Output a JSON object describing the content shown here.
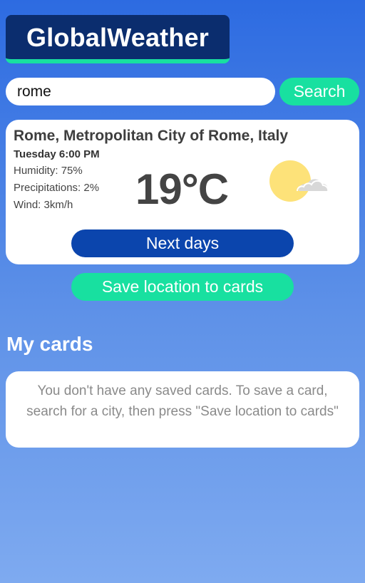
{
  "app": {
    "logo_text": "GlobalWeather"
  },
  "search": {
    "value": "rome",
    "button_label": "Search"
  },
  "weather": {
    "location": "Rome, Metropolitan City of Rome, Italy",
    "datetime": "Tuesday 6:00 PM",
    "humidity_label": "Humidity:",
    "humidity_value": "75%",
    "precipitation_label": "Precipitations:",
    "precipitation_value": "2%",
    "wind_label": "Wind:",
    "wind_value": "3km/h",
    "temperature": "19°C",
    "icon": "partly-sunny-icon",
    "next_days_label": "Next days"
  },
  "actions": {
    "save_location_label": "Save location to cards"
  },
  "cards": {
    "title": "My cards",
    "empty_message": "You don't have any saved cards. To save a card, search for a city, then press \"Save location to cards\""
  },
  "colors": {
    "accent": "#18e0a0",
    "logo_bg": "#0b2d6e",
    "next_days_button": "#0b45ad",
    "background_top": "#2d6be1",
    "background_bottom": "#7eaaf0"
  }
}
